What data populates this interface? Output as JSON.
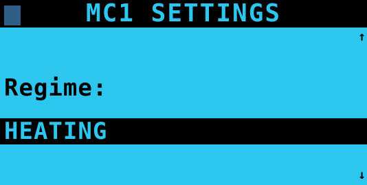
{
  "header": {
    "title": "MC1 SETTINGS"
  },
  "scroll": {
    "up_glyph": "↑",
    "down_glyph": "↓"
  },
  "field": {
    "label": "Regime:",
    "value": "HEATING"
  },
  "colors": {
    "screen_background": "#2dc6ef",
    "bar_background": "#000000",
    "marker": "#2f5e86"
  }
}
